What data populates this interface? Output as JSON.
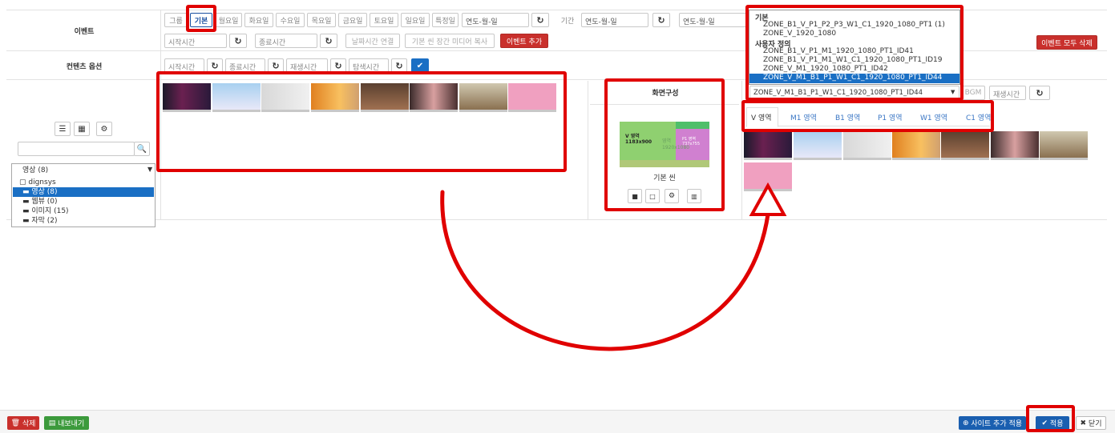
{
  "event_row": {
    "label": "이벤트",
    "day_buttons": [
      "그룹",
      "기본",
      "월요일",
      "화요일",
      "수요일",
      "목요일",
      "금요일",
      "토요일",
      "일요일",
      "특정일"
    ],
    "date_placeholder_1": "연도-월-일",
    "period_label": "기간",
    "date_placeholder_2": "연도-월-일",
    "date_placeholder_3": "연도-월-일",
    "start_time": "시작시간",
    "end_time": "종료시간",
    "date_time_link": "날짜시간 연결",
    "copy_media": "기본 씬 장간 미디어 복사",
    "add_event": "이벤트 추가",
    "delete_all_events": "이벤트 모두 삭제"
  },
  "content_row": {
    "label": "컨텐츠 옵션",
    "start_time": "시작시간",
    "end_time": "종료시간",
    "play_time": "재생시간",
    "seek_time": "탐색시간"
  },
  "left_panel": {
    "search_placeholder": "",
    "folder_select": "영상 (8)",
    "tree_root": "dignsys",
    "tree_items": [
      "영상 (8)",
      "웹뷰 (0)",
      "이미지 (15)",
      "자막 (2)"
    ]
  },
  "screen_config": {
    "title": "화면구성",
    "layout_v_label": "V 영역",
    "layout_v_size": "1183x900",
    "layout_v_overlay": "영역",
    "layout_v_overlay2": "1920x1080",
    "layout_p_label": "P1 영역",
    "layout_p_size": "737x755",
    "scene_name": "기본 씬"
  },
  "zone_dropdown": {
    "group1": "기본",
    "options1": [
      "ZONE_B1_V_P1_P2_P3_W1_C1_1920_1080_PT1 (1)",
      "ZONE_V_1920_1080"
    ],
    "group2": "사용자 정의",
    "options2": [
      "ZONE_B1_V_P1_M1_1920_1080_PT1_ID41",
      "ZONE_B1_V_P1_M1_W1_C1_1920_1080_PT1_ID19",
      "ZONE_V_M1_1920_1080_PT1_ID42",
      "ZONE_V_M1_B1_P1_W1_C1_1920_1080_PT1_ID44"
    ],
    "selected": "ZONE_V_M1_B1_P1_W1_C1_1920_1080_PT1_ID44",
    "bgm": "BGM",
    "play_time": "재생시간"
  },
  "zone_tabs": [
    "V 영역",
    "M1 영역",
    "B1 영역",
    "P1 영역",
    "W1 영역",
    "C1 영역"
  ],
  "footer": {
    "delete": "삭제",
    "export": "내보내기",
    "site_add_apply": "사이트 추가 적용",
    "apply": "적용",
    "close": "닫기"
  },
  "colors": {
    "accent_red": "#e00000",
    "primary_blue": "#1a6fc4",
    "danger_red": "#c9302c",
    "success_green": "#3c9a3c"
  }
}
